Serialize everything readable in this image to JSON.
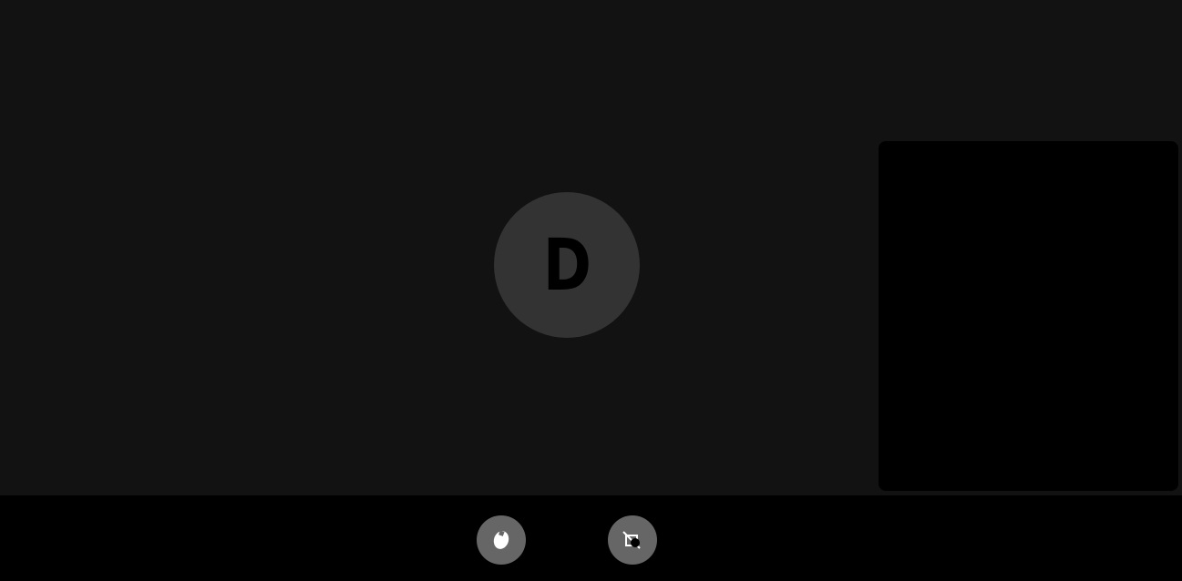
{
  "call": {
    "remote_participant": {
      "avatar_initial": "D",
      "avatar_color": "#333333"
    },
    "self_view": {
      "state": "video-off"
    }
  },
  "controls": {
    "background": "#000000",
    "button_color": "#666666",
    "buttons": [
      {
        "id": "mic",
        "icon": "microphone-icon"
      },
      {
        "id": "camera",
        "icon": "camera-off-icon"
      }
    ]
  },
  "colors": {
    "stage_background": "#121212",
    "self_view_background": "#000000"
  }
}
